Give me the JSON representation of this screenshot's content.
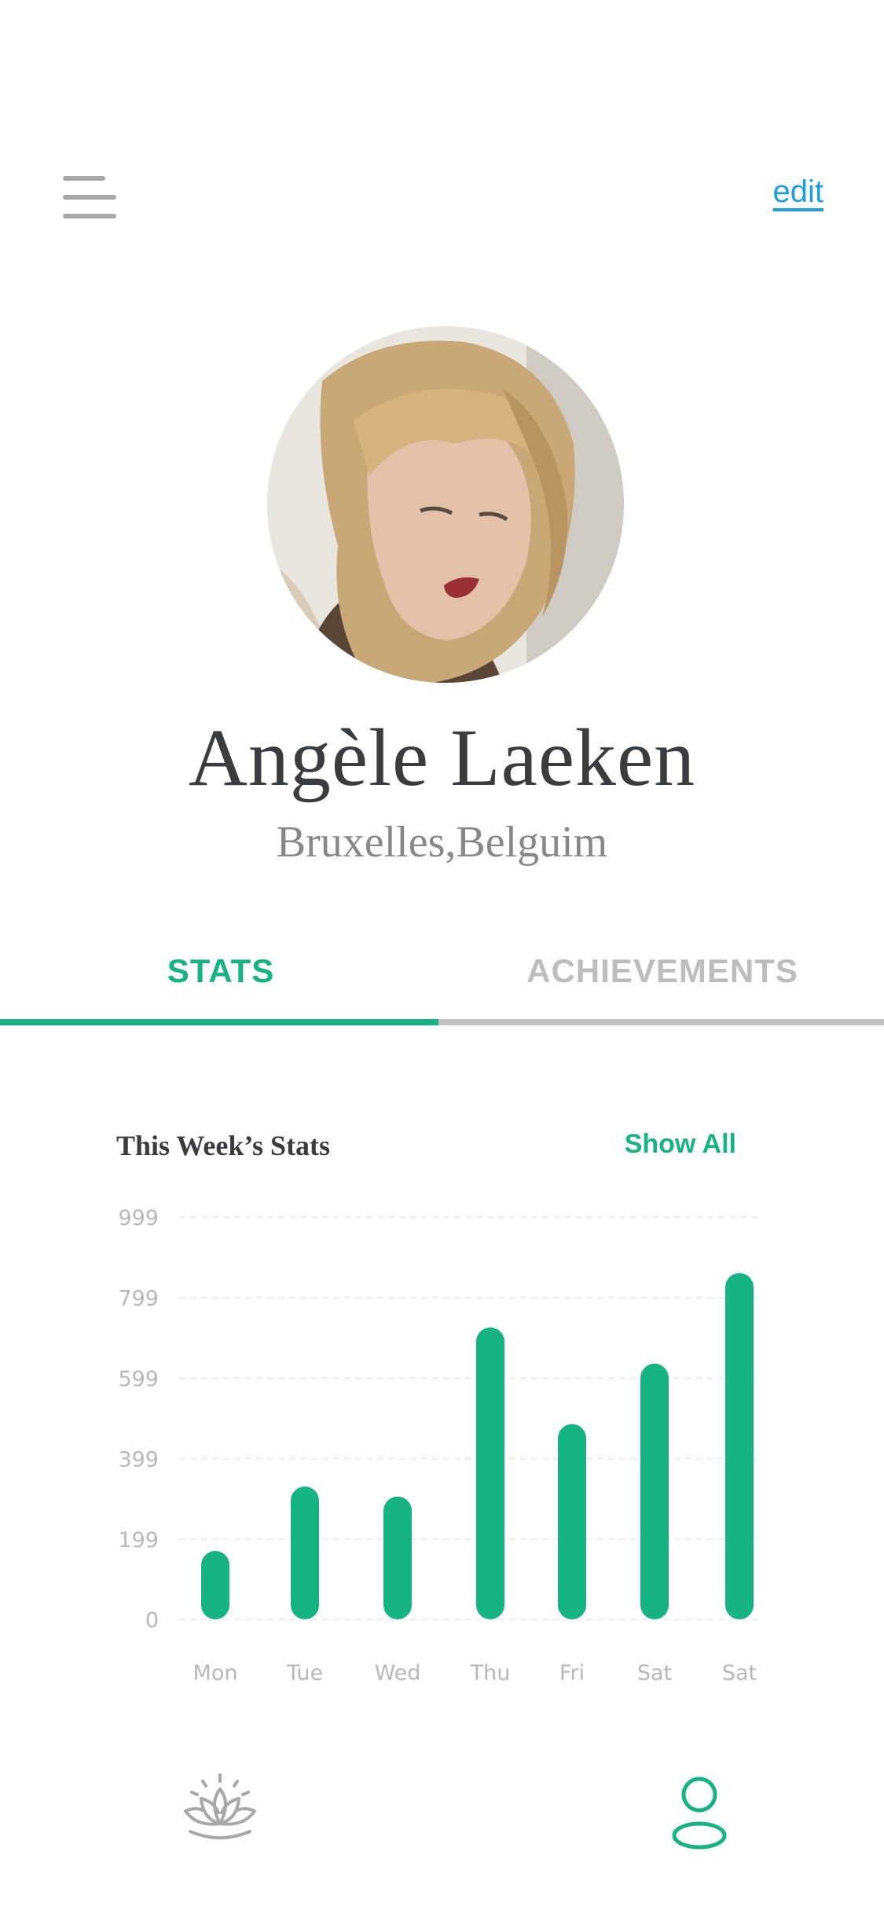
{
  "header": {
    "menu_icon": "hamburger-menu-icon",
    "edit_label": "edit"
  },
  "profile": {
    "name": "Angèle Laeken",
    "location": "Bruxelles,Belguim"
  },
  "tabs": [
    {
      "label": "STATS",
      "active": true
    },
    {
      "label": "ACHIEVEMENTS",
      "active": false
    }
  ],
  "stats": {
    "title": "This Week’s Stats",
    "show_all_label": "Show All"
  },
  "colors": {
    "accent": "#17b483",
    "link": "#1a9fe3",
    "text_dark": "#3a3d40",
    "text_muted": "#86898c"
  },
  "chart_data": {
    "type": "bar",
    "categories": [
      "Mon",
      "Tue",
      "Wed",
      "Thu",
      "Fri",
      "Sat",
      "Sat"
    ],
    "values": [
      170,
      330,
      305,
      725,
      485,
      635,
      860
    ],
    "ylim": [
      0,
      999
    ],
    "yticks": [
      0,
      199,
      399,
      599,
      799,
      999
    ],
    "title": "",
    "xlabel": "",
    "ylabel": "",
    "grid": true,
    "legend": "none"
  },
  "nav": {
    "items": [
      {
        "icon": "lotus-meditation-icon",
        "active": false
      },
      {
        "icon": "user-profile-icon",
        "active": true
      }
    ]
  }
}
